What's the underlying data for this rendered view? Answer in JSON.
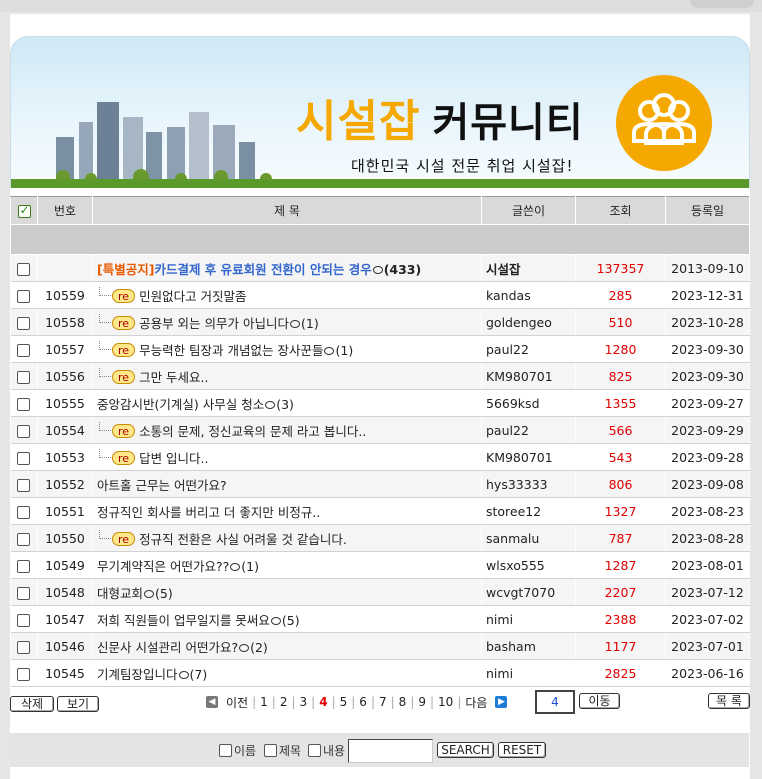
{
  "header": {
    "brand_part1": "시설잡",
    "brand_part2": "커뮤니티",
    "slogan": "대한민국 시설 전문 취업 시설잡!"
  },
  "table": {
    "columns": {
      "no": "번호",
      "title": "제 목",
      "writer": "글쓴이",
      "hits": "조회",
      "date": "등록일"
    },
    "notice": {
      "tag": "[특별공지]",
      "title": "카드결제 후 유료회원 전환이 안되는 경우",
      "comments": "(433)",
      "writer": "시설잡",
      "hits": "137357",
      "date": "2013-09-10"
    },
    "rows": [
      {
        "no": "10559",
        "reply": true,
        "title": "민원없다고 거짓말좀",
        "comments": "",
        "writer": "kandas",
        "hits": "285",
        "date": "2023-12-31"
      },
      {
        "no": "10558",
        "reply": true,
        "title": "공용부 외는 의무가 아닙니다",
        "comments": "(1)",
        "writer": "goldengeo",
        "hits": "510",
        "date": "2023-10-28"
      },
      {
        "no": "10557",
        "reply": true,
        "title": "무능력한 팀장과 개념없는 장사꾼들",
        "comments": "(1)",
        "writer": "paul22",
        "hits": "1280",
        "date": "2023-09-30"
      },
      {
        "no": "10556",
        "reply": true,
        "title": "그만 두세요..",
        "comments": "",
        "writer": "KM980701",
        "hits": "825",
        "date": "2023-09-30"
      },
      {
        "no": "10555",
        "reply": false,
        "title": "중앙감시반(기계실) 사무실 청소",
        "comments": "(3)",
        "writer": "5669ksd",
        "hits": "1355",
        "date": "2023-09-27"
      },
      {
        "no": "10554",
        "reply": true,
        "title": "소통의 문제, 정신교육의 문제 라고 봅니다..",
        "comments": "",
        "writer": "paul22",
        "hits": "566",
        "date": "2023-09-29"
      },
      {
        "no": "10553",
        "reply": true,
        "title": "답변 입니다..",
        "comments": "",
        "writer": "KM980701",
        "hits": "543",
        "date": "2023-09-28"
      },
      {
        "no": "10552",
        "reply": false,
        "title": "아트홀 근무는 어떤가요?",
        "comments": "",
        "writer": "hys33333",
        "hits": "806",
        "date": "2023-09-08"
      },
      {
        "no": "10551",
        "reply": false,
        "title": "정규직인 회사를 버리고 더 좋지만 비정규..",
        "comments": "",
        "writer": "storee12",
        "hits": "1327",
        "date": "2023-08-23"
      },
      {
        "no": "10550",
        "reply": true,
        "title": "정규직 전환은 사실 어려울 것 같습니다.",
        "comments": "",
        "writer": "sanmalu",
        "hits": "787",
        "date": "2023-08-28"
      },
      {
        "no": "10549",
        "reply": false,
        "title": "무기계약직은 어떤가요??",
        "comments": "(1)",
        "writer": "wlsxo555",
        "hits": "1287",
        "date": "2023-08-01"
      },
      {
        "no": "10548",
        "reply": false,
        "title": "대형교회",
        "comments": "(5)",
        "writer": "wcvgt7070",
        "hits": "2207",
        "date": "2023-07-12"
      },
      {
        "no": "10547",
        "reply": false,
        "title": "저희 직원들이 업무일지를 못써요",
        "comments": "(5)",
        "writer": "nimi",
        "hits": "2388",
        "date": "2023-07-02"
      },
      {
        "no": "10546",
        "reply": false,
        "title": "신문사 시설관리 어떤가요?",
        "comments": "(2)",
        "writer": "basham",
        "hits": "1177",
        "date": "2023-07-01"
      },
      {
        "no": "10545",
        "reply": false,
        "title": "기계팀장입니다",
        "comments": "(7)",
        "writer": "nimi",
        "hits": "2825",
        "date": "2023-06-16"
      }
    ],
    "reply_badge": "re"
  },
  "buttons": {
    "delete": "삭제",
    "view": "보기",
    "go": "이동",
    "list": "목 록",
    "search": "SEARCH",
    "reset": "RESET"
  },
  "pager": {
    "prev": "이전",
    "next": "다음",
    "pages": [
      "1",
      "2",
      "3",
      "4",
      "5",
      "6",
      "7",
      "8",
      "9",
      "10"
    ],
    "current": "4",
    "goto_value": "4"
  },
  "search": {
    "opt_name": "이름",
    "opt_title": "제목",
    "opt_content": "내용",
    "query": ""
  },
  "colors": {
    "accent": "#f5a800",
    "hits_red": "#e00000",
    "notice_orange": "#e85a00",
    "notice_blue": "#3366cc"
  },
  "icons": {
    "comment": "speech-bubble-icon",
    "prev": "arrow-left-icon",
    "next": "arrow-right-icon",
    "logo": "group-people-icon"
  }
}
